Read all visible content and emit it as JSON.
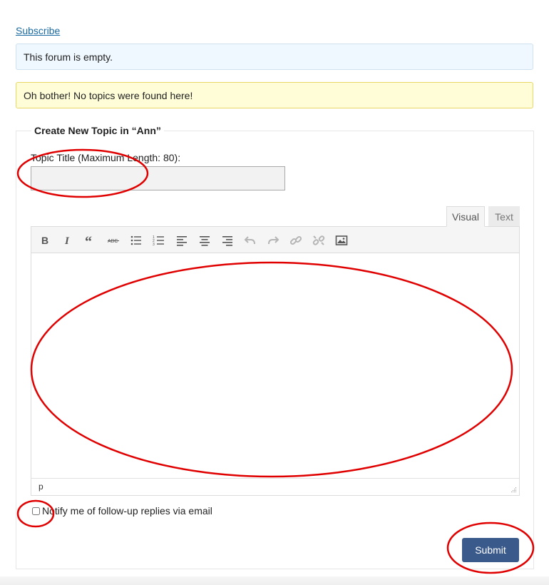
{
  "subscribe_link": "Subscribe",
  "notices": {
    "info": "This forum is empty.",
    "warning": "Oh bother! No topics were found here!"
  },
  "form": {
    "legend": "Create New Topic in “Ann”",
    "title_label": "Topic Title (Maximum Length: 80):",
    "title_value": "",
    "tabs": {
      "visual": "Visual",
      "text": "Text"
    },
    "toolbar_icons": [
      "bold-icon",
      "italic-icon",
      "blockquote-icon",
      "strikethrough-icon",
      "bulleted-list-icon",
      "numbered-list-icon",
      "align-left-icon",
      "align-center-icon",
      "align-right-icon",
      "undo-icon",
      "redo-icon",
      "link-icon",
      "unlink-icon",
      "image-icon"
    ],
    "editor_content": "",
    "path_indicator": "p",
    "notify_label": "Notify me of follow-up replies via email",
    "notify_checked": false,
    "submit_label": "Submit"
  },
  "colors": {
    "link": "#1a6aa0",
    "info_bg": "#f0f8ff",
    "warning_bg": "#fffdd8",
    "submit_bg": "#3b5a8c",
    "annotation": "#e00000"
  }
}
